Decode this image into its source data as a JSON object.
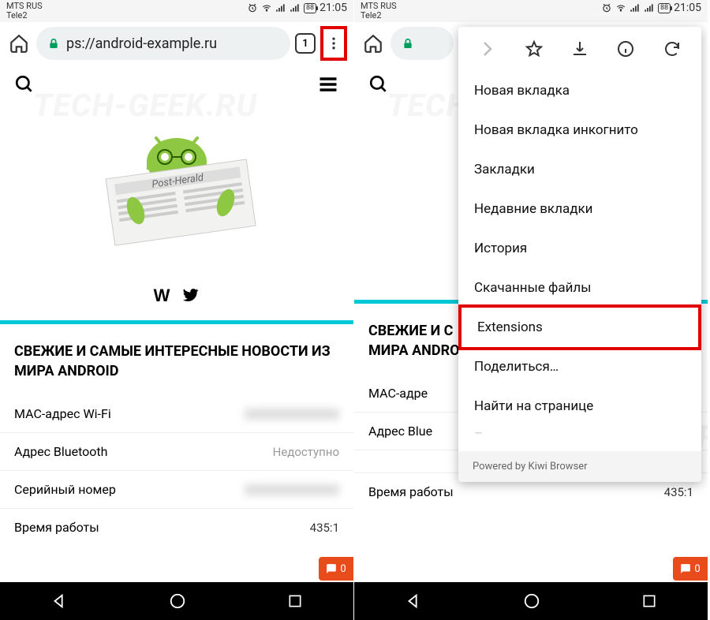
{
  "status": {
    "carrier_line1": "MTS RUS",
    "carrier_line2": "Tele2",
    "battery": "88",
    "time": "21:05"
  },
  "browser": {
    "url_visible": "ps://android-example.ru",
    "tab_count": "1"
  },
  "page": {
    "heading": "СВЕЖИЕ И САМЫЕ ИНТЕРЕСНЫЕ НОВОСТИ ИЗ МИРА ANDROID",
    "heading_cut": "СВЕЖИЕ И С",
    "heading_cut2": "МИРА ANDRO",
    "rows": [
      {
        "label": "MAC-адрес Wi-Fi",
        "value": ""
      },
      {
        "label": "Адрес Bluetooth",
        "value": "Недоступно"
      },
      {
        "label": "Серийный номер",
        "value": ""
      },
      {
        "label": "Время работы",
        "value": "435:1"
      }
    ],
    "row2_label_cut": "MAC-адре",
    "row3_label_cut": "Адрес Blue",
    "chat_count": "0"
  },
  "menu": {
    "items": [
      "Новая вкладка",
      "Новая вкладка инкогнито",
      "Закладки",
      "Недавние вкладки",
      "История",
      "Скачанные файлы",
      "Extensions",
      "Поделиться…",
      "Найти на странице"
    ],
    "footer": "Powered by Kiwi Browser"
  },
  "watermark": "TECH-GEEK.RU"
}
